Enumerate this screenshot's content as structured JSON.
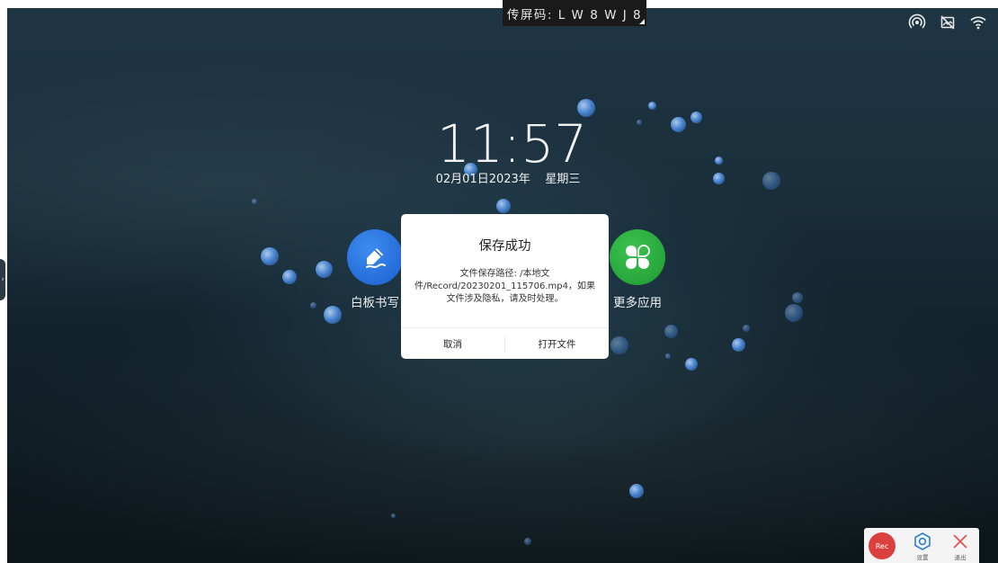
{
  "top_bar": {
    "cast_code": "传屏码: L W 8 W J 8"
  },
  "status_icons": [
    "hotspot-icon",
    "no-image-icon",
    "wifi-icon"
  ],
  "clock": {
    "time": "11:57",
    "date": "02月01日2023年",
    "weekday": "星期三"
  },
  "apps": {
    "whiteboard": {
      "label": "白板书写",
      "icon": "pen-icon",
      "color": "#1e6fe0"
    },
    "more": {
      "label": "更多应用",
      "icon": "four-leaf-icon",
      "color": "#24a93a"
    }
  },
  "dialog": {
    "title": "保存成功",
    "message": "文件保存路径: /本地文件/Record/20230201_115706.mp4，如果文件涉及隐私，请及时处理。",
    "cancel_label": "取消",
    "open_label": "打开文件"
  },
  "recorder": {
    "rec_label": "Rec",
    "settings_label": "设置",
    "exit_label": "退出",
    "rec_color": "#d9403e",
    "settings_color": "#2a7fd4",
    "exit_color": "#e05050"
  }
}
